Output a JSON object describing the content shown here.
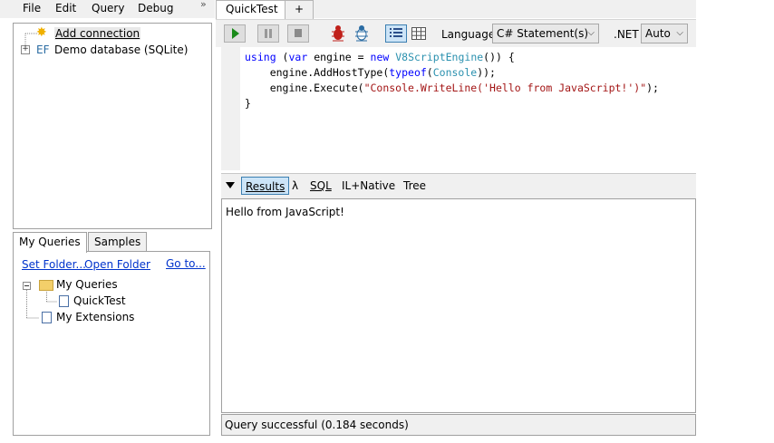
{
  "menu": {
    "file": "File",
    "edit": "Edit",
    "query": "Query",
    "debug": "Debug",
    "overflow": "»"
  },
  "connections": {
    "add_connection": "Add connection",
    "demo_db_prefix": "EF",
    "demo_db": "Demo database (SQLite)"
  },
  "queries_panel": {
    "tabs": [
      "My Queries",
      "Samples"
    ],
    "links": {
      "set_folder": "Set Folder...",
      "open_folder": "Open Folder",
      "go_to": "Go to..."
    },
    "tree": {
      "my_queries": "My Queries",
      "quick_test": "QuickTest",
      "my_extensions": "My Extensions"
    }
  },
  "query_tabs": {
    "active": "QuickTest",
    "new_tab": "+"
  },
  "toolbar": {
    "language_label": "Language",
    "language_value": "C# Statement(s)",
    "dotnet_label": ".NET",
    "dotnet_value": "Auto"
  },
  "code_lines": [
    [
      {
        "t": "using",
        "c": "kw"
      },
      {
        "t": " (",
        "c": ""
      },
      {
        "t": "var",
        "c": "kw"
      },
      {
        "t": " engine = ",
        "c": ""
      },
      {
        "t": "new",
        "c": "kw"
      },
      {
        "t": " ",
        "c": ""
      },
      {
        "t": "V8ScriptEngine",
        "c": "ty"
      },
      {
        "t": "()) {",
        "c": ""
      }
    ],
    [
      {
        "t": "    engine.AddHostType(",
        "c": ""
      },
      {
        "t": "typeof",
        "c": "kw"
      },
      {
        "t": "(",
        "c": ""
      },
      {
        "t": "Console",
        "c": "ty"
      },
      {
        "t": "));",
        "c": ""
      }
    ],
    [
      {
        "t": "    engine.Execute(",
        "c": ""
      },
      {
        "t": "\"Console.WriteLine('Hello from JavaScript!')\"",
        "c": "str"
      },
      {
        "t": ");",
        "c": ""
      }
    ],
    [
      {
        "t": "}",
        "c": ""
      }
    ]
  ],
  "results_tabs": {
    "results": "Results",
    "lambda": "λ",
    "sql": "SQL",
    "il_native": "IL+Native",
    "tree": "Tree"
  },
  "output": "Hello from JavaScript!",
  "status": "Query successful  (0.184 seconds)"
}
